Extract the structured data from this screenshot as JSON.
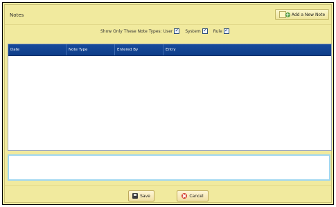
{
  "window": {
    "title": "Notes"
  },
  "toolbar": {
    "add_label": "Add a New Note"
  },
  "filters": {
    "label": "Show Only These Note Types:",
    "options": [
      {
        "label": "User",
        "checked": true
      },
      {
        "label": "System",
        "checked": true
      },
      {
        "label": "Rule",
        "checked": true
      }
    ]
  },
  "table": {
    "columns": [
      "Date",
      "Note Type",
      "Entered By",
      "Entry"
    ],
    "rows": []
  },
  "entry": {
    "value": ""
  },
  "footer": {
    "save_label": "Save",
    "cancel_label": "Cancel"
  },
  "colors": {
    "header_blue": "#174a9b",
    "panel_yellow": "#f1ea9e",
    "entry_border": "#9fd7f2"
  }
}
